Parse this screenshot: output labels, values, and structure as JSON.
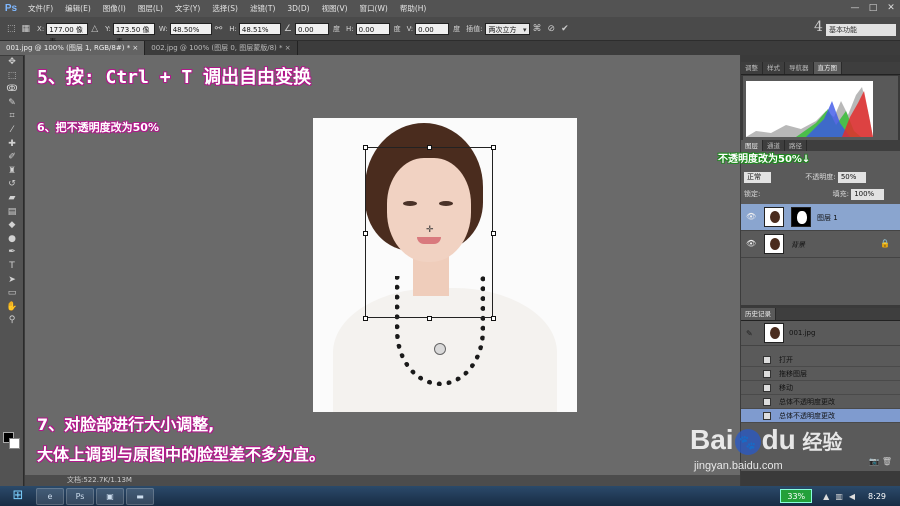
{
  "app": {
    "logo": "Ps"
  },
  "menu": [
    "文件(F)",
    "编辑(E)",
    "图像(I)",
    "图层(L)",
    "文字(Y)",
    "选择(S)",
    "滤镜(T)",
    "3D(D)",
    "视图(V)",
    "窗口(W)",
    "帮助(H)"
  ],
  "window_controls": [
    "—",
    "□",
    "✕"
  ],
  "options": {
    "x_label": "X:",
    "x_value": "177.00 像素",
    "y_label": "Y:",
    "y_value": "173.50 像素",
    "w_label": "W:",
    "w_value": "48.50%",
    "h_label": "H:",
    "h_value": "48.51%",
    "angle_value": "0.00",
    "angle_unit": "度",
    "hskew_label": "H:",
    "hskew_value": "0.00",
    "hskew_unit": "度",
    "vskew_label": "V:",
    "vskew_value": "0.00",
    "vskew_unit": "度",
    "interp_label": "插值:",
    "interp_value": "两次立方",
    "workspace_number": "4",
    "workspace": "基本功能"
  },
  "tabs": [
    {
      "label": "001.jpg @ 100% (图层 1, RGB/8#) *  ×"
    },
    {
      "label": "002.jpg @ 100% (图层 0, 图层蒙版/8) *  ×"
    }
  ],
  "annotations": {
    "step5": "5、按: Ctrl + T 调出自由变换",
    "step6": "6、把不透明度改为50%",
    "step7_line1": "7、对脸部进行大小调整,",
    "step7_line2": "大体上调到与原图中的脸型差不多为宜。",
    "opacity_note": "不透明度改为50%↓"
  },
  "status": {
    "doc": "文档:522.7K/1.13M"
  },
  "panels": {
    "top_tabs": [
      "调整",
      "样式",
      "导航器",
      "直方图"
    ],
    "layer_tabs": [
      "图层",
      "通道",
      "路径"
    ],
    "blend_mode": "正常",
    "opacity_label": "不透明度:",
    "opacity_value": "50%",
    "lock_label": "锁定:",
    "fill_label": "填充:",
    "fill_value": "100%",
    "layers": [
      {
        "name": "图层 1"
      },
      {
        "name": "背景"
      }
    ],
    "history_title": "历史记录",
    "history_snapshot": "001.jpg",
    "history_items": [
      "打开",
      "拖移图层",
      "移动",
      "总体不透明度更改",
      "总体不透明度更改"
    ]
  },
  "watermark": {
    "logo": "Bai",
    "logo_end": "du",
    "cn": "经验",
    "url": "jingyan.baidu.com"
  },
  "taskbar": {
    "cpu": "33%",
    "clock": "8:29"
  },
  "colors": {
    "accent_pink": "#b0188a",
    "accent_green": "#1b8a1b",
    "selection": "#8aa5cf"
  }
}
